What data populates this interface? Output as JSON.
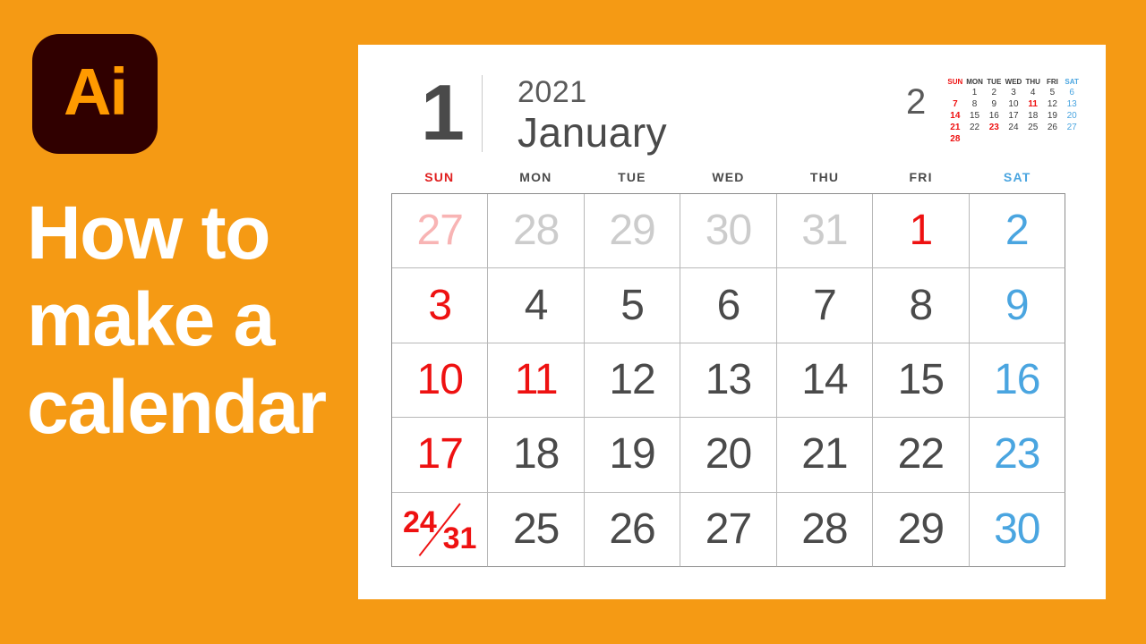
{
  "background_color": "#F59A14",
  "colors": {
    "sunday_red": "#EE1111",
    "saturday_blue": "#4AA5E0",
    "weekday_gray": "#4A4A4A",
    "muted_gray": "#CCCCCC",
    "muted_red": "#F8B4B4",
    "card_white": "#FFFFFF",
    "logo_dark": "#300000",
    "logo_orange": "#FF9A00"
  },
  "promo": {
    "logo_text": "Ai",
    "title_lines": [
      "How to",
      "make a",
      "calendar"
    ]
  },
  "calendar": {
    "month_number": "1",
    "year": "2021",
    "month_name": "January",
    "weekday_headers": [
      "SUN",
      "MON",
      "TUE",
      "WED",
      "THU",
      "FRI",
      "SAT"
    ],
    "weeks": [
      [
        {
          "label": "27",
          "style": "muted-red"
        },
        {
          "label": "28",
          "style": "muted"
        },
        {
          "label": "29",
          "style": "muted"
        },
        {
          "label": "30",
          "style": "muted"
        },
        {
          "label": "31",
          "style": "muted"
        },
        {
          "label": "1",
          "style": "red"
        },
        {
          "label": "2",
          "style": "blue"
        }
      ],
      [
        {
          "label": "3",
          "style": "red"
        },
        {
          "label": "4",
          "style": "gray"
        },
        {
          "label": "5",
          "style": "gray"
        },
        {
          "label": "6",
          "style": "gray"
        },
        {
          "label": "7",
          "style": "gray"
        },
        {
          "label": "8",
          "style": "gray"
        },
        {
          "label": "9",
          "style": "blue"
        }
      ],
      [
        {
          "label": "10",
          "style": "red"
        },
        {
          "label": "11",
          "style": "red"
        },
        {
          "label": "12",
          "style": "gray"
        },
        {
          "label": "13",
          "style": "gray"
        },
        {
          "label": "14",
          "style": "gray"
        },
        {
          "label": "15",
          "style": "gray"
        },
        {
          "label": "16",
          "style": "blue"
        }
      ],
      [
        {
          "label": "17",
          "style": "red"
        },
        {
          "label": "18",
          "style": "gray"
        },
        {
          "label": "19",
          "style": "gray"
        },
        {
          "label": "20",
          "style": "gray"
        },
        {
          "label": "21",
          "style": "gray"
        },
        {
          "label": "22",
          "style": "gray"
        },
        {
          "label": "23",
          "style": "blue"
        }
      ],
      [
        {
          "label": "24",
          "label_secondary": "31",
          "style": "red",
          "split": true
        },
        {
          "label": "25",
          "style": "gray"
        },
        {
          "label": "26",
          "style": "gray"
        },
        {
          "label": "27",
          "style": "gray"
        },
        {
          "label": "28",
          "style": "gray"
        },
        {
          "label": "29",
          "style": "gray"
        },
        {
          "label": "30",
          "style": "blue"
        }
      ]
    ]
  },
  "mini_calendar": {
    "month_number": "2",
    "weekday_headers": [
      "SUN",
      "MON",
      "TUE",
      "WED",
      "THU",
      "FRI",
      "SAT"
    ],
    "weeks": [
      [
        {
          "label": "",
          "style": "empty"
        },
        {
          "label": "1",
          "style": "gray"
        },
        {
          "label": "2",
          "style": "gray"
        },
        {
          "label": "3",
          "style": "gray"
        },
        {
          "label": "4",
          "style": "gray"
        },
        {
          "label": "5",
          "style": "gray"
        },
        {
          "label": "6",
          "style": "blue"
        }
      ],
      [
        {
          "label": "7",
          "style": "red"
        },
        {
          "label": "8",
          "style": "gray"
        },
        {
          "label": "9",
          "style": "gray"
        },
        {
          "label": "10",
          "style": "gray"
        },
        {
          "label": "11",
          "style": "red"
        },
        {
          "label": "12",
          "style": "gray"
        },
        {
          "label": "13",
          "style": "blue"
        }
      ],
      [
        {
          "label": "14",
          "style": "red"
        },
        {
          "label": "15",
          "style": "gray"
        },
        {
          "label": "16",
          "style": "gray"
        },
        {
          "label": "17",
          "style": "gray"
        },
        {
          "label": "18",
          "style": "gray"
        },
        {
          "label": "19",
          "style": "gray"
        },
        {
          "label": "20",
          "style": "blue"
        }
      ],
      [
        {
          "label": "21",
          "style": "red"
        },
        {
          "label": "22",
          "style": "gray"
        },
        {
          "label": "23",
          "style": "red"
        },
        {
          "label": "24",
          "style": "gray"
        },
        {
          "label": "25",
          "style": "gray"
        },
        {
          "label": "26",
          "style": "gray"
        },
        {
          "label": "27",
          "style": "blue"
        }
      ],
      [
        {
          "label": "28",
          "style": "red"
        },
        {
          "label": "",
          "style": "empty"
        },
        {
          "label": "",
          "style": "empty"
        },
        {
          "label": "",
          "style": "empty"
        },
        {
          "label": "",
          "style": "empty"
        },
        {
          "label": "",
          "style": "empty"
        },
        {
          "label": "",
          "style": "empty"
        }
      ]
    ]
  }
}
